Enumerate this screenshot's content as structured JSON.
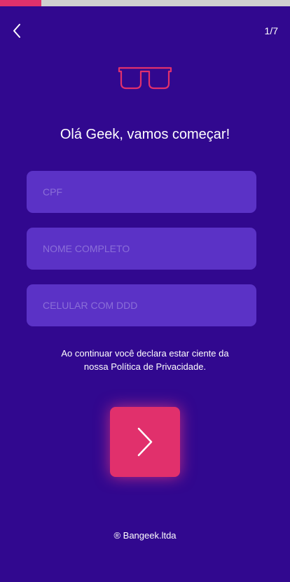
{
  "progress": {
    "current_step": 1,
    "total_steps": 7,
    "fraction": 0.143,
    "fill_color": "#e1306c",
    "track_color": "#d0d0d0"
  },
  "header": {
    "back_icon": "chevron-left-icon",
    "step_label": "1/7"
  },
  "logo": {
    "icon": "glasses-icon",
    "color": "#e1306c"
  },
  "title": "Olá Geek, vamos começar!",
  "form": {
    "cpf_placeholder": "CPF",
    "name_placeholder": "NOME COMPLETO",
    "phone_placeholder": "CELULAR COM DDD"
  },
  "disclaimer": {
    "line1": "Ao continuar você declara estar ciente da",
    "line2": "nossa Política de Privacidade."
  },
  "next_button": {
    "icon": "chevron-right-icon",
    "color": "#e1306c"
  },
  "footer": "® Bangeek.ltda",
  "colors": {
    "background": "#31088f",
    "field_background": "#5b32c6",
    "placeholder": "#8b6fd8"
  }
}
